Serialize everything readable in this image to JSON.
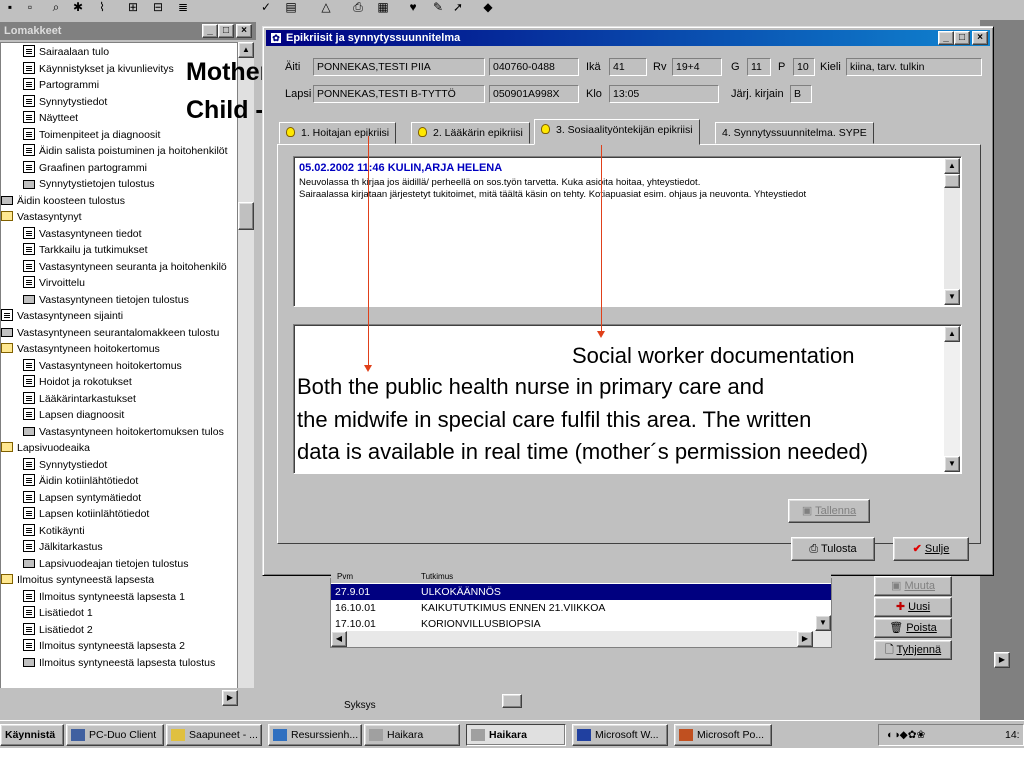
{
  "left_panel": {
    "title": "Lomakkeet",
    "items": [
      {
        "label": "Sairaalaan tulo",
        "icon": "doc"
      },
      {
        "label": "Käynnistykset ja kivunlievitys",
        "icon": "doc"
      },
      {
        "label": "Partogrammi",
        "icon": "doc"
      },
      {
        "label": "Synnytystiedot",
        "icon": "doc"
      },
      {
        "label": "Näytteet",
        "icon": "doc"
      },
      {
        "label": "Toimenpiteet ja diagnoosit",
        "icon": "doc"
      },
      {
        "label": "Äidin salista poistuminen ja hoitohenkilöt",
        "icon": "doc"
      },
      {
        "label": "Graafinen partogrammi",
        "icon": "doc"
      },
      {
        "label": "Synnytystietojen tulostus",
        "icon": "printer"
      },
      {
        "label": "Äidin koosteen tulostus",
        "icon": "printer"
      },
      {
        "label": "Vastasyntynyt",
        "icon": "folder"
      },
      {
        "label": "Vastasyntyneen tiedot",
        "icon": "doc"
      },
      {
        "label": "Tarkkailu ja tutkimukset",
        "icon": "doc"
      },
      {
        "label": "Vastasyntyneen seuranta ja hoitohenkilö",
        "icon": "doc"
      },
      {
        "label": "Virvoittelu",
        "icon": "doc"
      },
      {
        "label": "Vastasyntyneen tietojen tulostus",
        "icon": "printer"
      },
      {
        "label": "Vastasyntyneen sijainti",
        "icon": "doc"
      },
      {
        "label": "Vastasyntyneen seurantalomakkeen tulostu",
        "icon": "printer"
      },
      {
        "label": "Vastasyntyneen hoitokertomus",
        "icon": "folder"
      },
      {
        "label": "Vastasyntyneen hoitokertomus",
        "icon": "doc"
      },
      {
        "label": "Hoidot ja rokotukset",
        "icon": "doc"
      },
      {
        "label": "Lääkärintarkastukset",
        "icon": "doc"
      },
      {
        "label": "Lapsen diagnoosit",
        "icon": "doc"
      },
      {
        "label": "Vastasyntyneen hoitokertomuksen tulos",
        "icon": "printer"
      },
      {
        "label": "Lapsivuodeaika",
        "icon": "folder"
      },
      {
        "label": "Synnytystiedot",
        "icon": "doc"
      },
      {
        "label": "Äidin kotiinlähtötiedot",
        "icon": "doc"
      },
      {
        "label": "Lapsen syntymätiedot",
        "icon": "doc"
      },
      {
        "label": "Lapsen kotiinlähtötiedot",
        "icon": "doc"
      },
      {
        "label": "Kotikäynti",
        "icon": "doc"
      },
      {
        "label": "Jälkitarkastus",
        "icon": "doc"
      },
      {
        "label": "Lapsivuodeajan tietojen tulostus",
        "icon": "printer"
      },
      {
        "label": "Ilmoitus syntyneestä lapsesta",
        "icon": "folder"
      },
      {
        "label": "Ilmoitus syntyneestä lapsesta 1",
        "icon": "doc"
      },
      {
        "label": "Lisätiedot 1",
        "icon": "doc"
      },
      {
        "label": "Lisätiedot 2",
        "icon": "doc"
      },
      {
        "label": "Ilmoitus syntyneestä lapsesta 2",
        "icon": "doc"
      },
      {
        "label": "Ilmoitus syntyneestä lapsesta tulostus",
        "icon": "printer"
      }
    ]
  },
  "annotations": {
    "mother": "Mother->,",
    "child": "Child  ->"
  },
  "dialog": {
    "title": "Epikriisit ja synnytyssuunnitelma",
    "mother_label": "Äiti",
    "mother_name": "PONNEKAS,TESTI PIIA",
    "mother_id": "040760-0488",
    "age_label": "Ikä",
    "age": "41",
    "rv_label": "Rv",
    "rv": "19+4",
    "g_label": "G",
    "g": "11",
    "p_label": "P",
    "p": "10",
    "language_label": "Kieli",
    "language": "kiina, tarv. tulkin",
    "child_label": "Lapsi",
    "child_name": "PONNEKAS,TESTI B-TYTTÖ",
    "child_id": "050901A998X",
    "time_label": "Klo",
    "time": "13:05",
    "order_label": "Järj. kirjain",
    "order": "B",
    "tabs": [
      "1. Hoitajan epikriisi",
      "2. Lääkärin epikriisi",
      "3. Sosiaalityöntekijän epikriisi",
      "4. Synnytyssuunnitelma. SYPE"
    ],
    "note_header": "05.02.2002 11:46 KULIN,ARJA HELENA",
    "note_line1": "Neuvolassa th kirjaa jos äidillä/ perheellä on sos.työn tarvetta. Kuka asioita hoitaa, yhteystiedot.",
    "note_line2": "Sairaalassa kirjataan järjestetyt tukitoimet, mitä täältä käsin on tehty. Kotiapuasiat esim. ohjaus ja neuvonta. Yhteystiedot",
    "text_line1": "Social worker documentation",
    "text_line2": "Both the public health nurse in primary care and",
    "text_line3": "the midwife in special care fulfil this area. The written",
    "text_line4": "data is available in real time (mother´s permission needed)",
    "save_label": "Tallenna",
    "print_label": "Tulosta",
    "close_label": "Sulje"
  },
  "bg_table": {
    "header_date": "Pvm",
    "header_desc": "Tutkimus",
    "rows": [
      {
        "date": "27.9.01",
        "desc": "ULKOKÄÄNNÖS"
      },
      {
        "date": "16.10.01",
        "desc": "KAIKUTUTKIMUS ENNEN 21.VIIKKOA"
      },
      {
        "date": "17.10.01",
        "desc": "KORIONVILLUSBIOPSIA"
      }
    ]
  },
  "bg_buttons": {
    "edit": "Muuta",
    "new": "Uusi",
    "delete": "Poista",
    "clear": "Tyhjennä"
  },
  "status_text": "Syksys",
  "taskbar": {
    "start": "Käynnistä",
    "tasks": [
      "PC-Duo Client",
      "Saapuneet - ...",
      "Resurssienh...",
      "Haikara",
      "Haikara",
      "Microsoft W...",
      "Microsoft Po..."
    ],
    "clock": "14:"
  }
}
